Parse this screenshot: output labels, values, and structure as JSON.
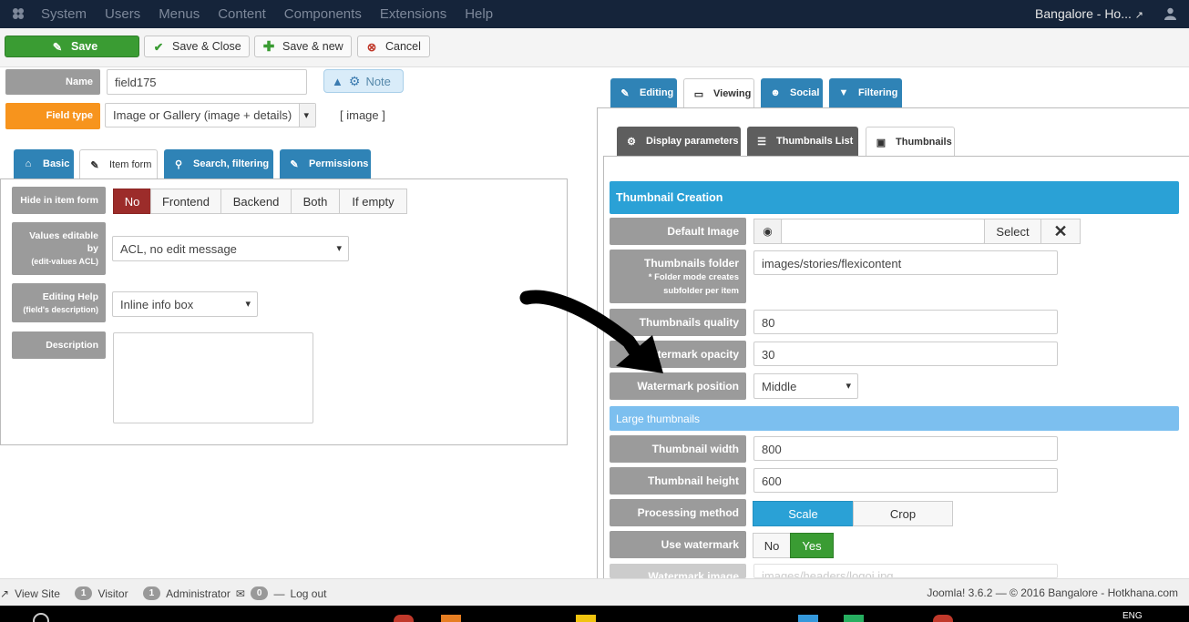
{
  "topbar": {
    "menu": [
      "System",
      "Users",
      "Menus",
      "Content",
      "Components",
      "Extensions",
      "Help"
    ],
    "site_name": "Bangalore - Ho..."
  },
  "toolbar": {
    "save": "Save",
    "save_close": "Save & Close",
    "save_new": "Save & new",
    "cancel": "Cancel"
  },
  "field": {
    "name_label": "Name",
    "name_value": "field175",
    "note": "Note",
    "type_label": "Field type",
    "type_value": "Image or Gallery (image + details)",
    "type_code": "[ image ]"
  },
  "left_tabs": [
    "Basic",
    "Item form",
    "Search, filtering",
    "Permissions"
  ],
  "item_form": {
    "hide_label": "Hide in item form",
    "hide_options": [
      "No",
      "Frontend",
      "Backend",
      "Both",
      "If empty"
    ],
    "values_label": "Values editable by",
    "values_sub": "(edit-values ACL)",
    "values_value": "ACL, no edit message",
    "help_label": "Editing Help",
    "help_sub": "(field's description)",
    "help_value": "Inline info box",
    "desc_label": "Description"
  },
  "right_tabs": [
    "Editing",
    "Viewing",
    "Social",
    "Filtering"
  ],
  "sub_tabs": [
    "Display parameters",
    "Thumbnails List",
    "Thumbnails"
  ],
  "thumbs": {
    "section_title": "Thumbnail Creation",
    "default_image_label": "Default Image",
    "select_btn": "Select",
    "folder_label": "Thumbnails folder",
    "folder_sub": "* Folder mode creates subfolder per item",
    "folder_value": "images/stories/flexicontent",
    "quality_label": "Thumbnails quality",
    "quality_value": "80",
    "opacity_label": "termark opacity",
    "opacity_value": "30",
    "position_label": "Watermark position",
    "position_value": "Middle",
    "large_title": "Large thumbnails",
    "width_label": "Thumbnail width",
    "width_value": "800",
    "height_label": "Thumbnail height",
    "height_value": "600",
    "method_label": "Processing method",
    "method_options": [
      "Scale",
      "Crop"
    ],
    "use_wm_label": "Use watermark",
    "use_wm_options": [
      "No",
      "Yes"
    ],
    "wm_image_label": "Watermark image",
    "wm_image_value": "images/headers/logoi.jpg"
  },
  "status": {
    "view_site": "View Site",
    "visitor_count": "1",
    "visitor": "Visitor",
    "admin_count": "1",
    "admin": "Administrator",
    "msg_count": "0",
    "logout": "Log out",
    "copyright": "Joomla! 3.6.2  —  © 2016 Bangalore - Hotkhana.com"
  },
  "tray": {
    "lang": "ENG"
  },
  "colors": {
    "brand_green": "#3a9c33",
    "tab_blue": "#2f83b6",
    "section_blue": "#2aa1d6",
    "light_blue": "#7cbfef",
    "danger": "#9c2c2a"
  }
}
